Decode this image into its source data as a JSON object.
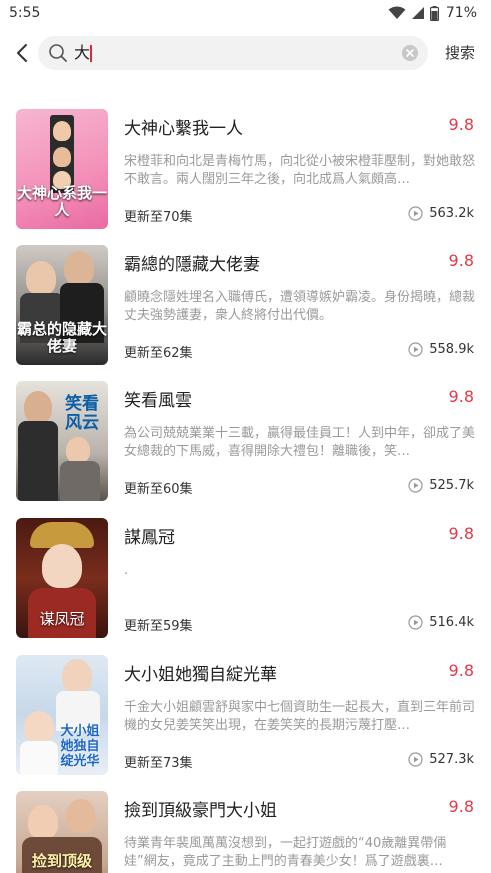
{
  "status_bar": {
    "time": "5:55",
    "battery": "71%",
    "icons": [
      "wifi-icon",
      "signal-icon",
      "battery-icon"
    ]
  },
  "search": {
    "query": "大",
    "button_label": "搜索",
    "icons": [
      "back-icon",
      "search-icon",
      "clear-icon"
    ]
  },
  "colors": {
    "accent": "#e8384a",
    "text": "#222222",
    "secondary": "#9a9a9a"
  },
  "results": [
    {
      "title": "大神心繫我一人",
      "score": "9.8",
      "description": "宋橙菲和向北是青梅竹馬，向北從小被宋橙菲壓制，對她敢怒不敢言。兩人闊別三年之後，向北成爲人氣頗高…",
      "episodes": "更新至70集",
      "views": "563.2k",
      "cover_text": "大神心系我一人"
    },
    {
      "title": "霸總的隱藏大佬妻",
      "score": "9.8",
      "description": "顧曉念隱姓埋名入職傅氏，遭領導嫉妒霸凌。身份揭曉，總裁丈夫強勢護妻，衆人終將付出代價。",
      "episodes": "更新至62集",
      "views": "558.9k",
      "cover_text": "霸总的隐藏大佬妻"
    },
    {
      "title": "笑看風雲",
      "score": "9.8",
      "description": "為公司兢兢業業十三載，贏得最佳員工！人到中年，卻成了美女總裁的下馬威，喜得開除大禮包！離職後，笑…",
      "episodes": "更新至60集",
      "views": "525.7k",
      "cover_text": "笑看风云"
    },
    {
      "title": "謀鳳冠",
      "score": "9.8",
      "description": ".",
      "episodes": "更新至59集",
      "views": "516.4k",
      "cover_text": "谋凤冠"
    },
    {
      "title": "大小姐她獨自綻光華",
      "score": "9.8",
      "description": "千金大小姐顧雲舒與家中七個資助生一起長大，直到三年前司機的女兒姜笑笑出現，在姜笑笑的長期污蔑打壓…",
      "episodes": "更新至73集",
      "views": "527.3k",
      "cover_text": "大小姐她独自绽光华"
    },
    {
      "title": "撿到頂級豪門大小姐",
      "score": "9.8",
      "description": "待業青年裴風萬萬沒想到，一起打遊戲的“40歲離異帶倆娃”網友，竟成了主動上門的青春美少女！爲了遊戲裏…",
      "episodes": "",
      "views": "",
      "cover_text": "捡到顶级"
    }
  ]
}
